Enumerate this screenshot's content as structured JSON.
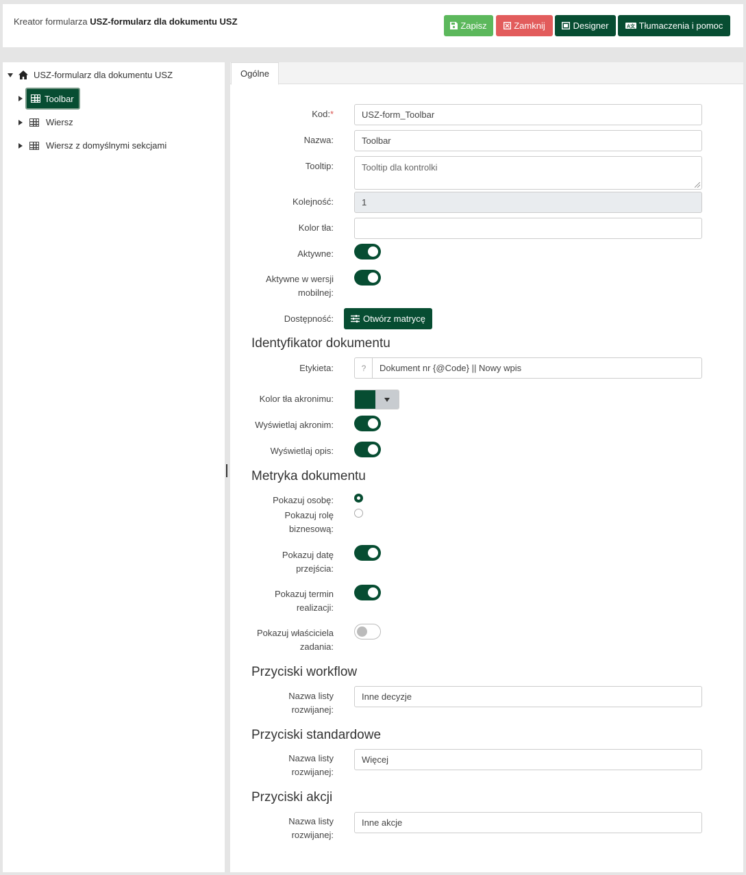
{
  "header": {
    "title_prefix": "Kreator formularza",
    "title_name": "USZ-formularz dla dokumentu USZ",
    "buttons": {
      "save": "Zapisz",
      "close": "Zamknij",
      "designer": "Designer",
      "translations": "Tłumaczenia i pomoc"
    }
  },
  "tree": {
    "root": "USZ-formularz dla dokumentu USZ",
    "items": [
      "Toolbar",
      "Wiersz",
      "Wiersz z domyślnymi sekcjami"
    ]
  },
  "tabs": [
    "Ogólne"
  ],
  "form": {
    "kod": {
      "label": "Kod:",
      "required": "*",
      "value": "USZ-form_Toolbar"
    },
    "nazwa": {
      "label": "Nazwa:",
      "value": "Toolbar"
    },
    "tooltip": {
      "label": "Tooltip:",
      "placeholder": "Tooltip dla kontrolki"
    },
    "kolejnosc": {
      "label": "Kolejność:",
      "value": "1"
    },
    "kolor_tla": {
      "label": "Kolor tła:",
      "value": ""
    },
    "aktywne": {
      "label": "Aktywne:",
      "on": true
    },
    "aktywne_mobile": {
      "label_1": "Aktywne w wersji",
      "label_2": "mobilnej:",
      "on": true
    },
    "dostepnosc": {
      "label": "Dostępność:",
      "button": "Otwórz matrycę"
    }
  },
  "identyfikator": {
    "title": "Identyfikator dokumentu",
    "etykieta": {
      "label": "Etykieta:",
      "addon": "?",
      "value": "Dokument nr {@Code} || Nowy wpis"
    },
    "kolor_akronimu": {
      "label": "Kolor tła akronimu:",
      "color": "#074d32"
    },
    "wyswietlaj_akronim": {
      "label": "Wyświetlaj akronim:",
      "on": true
    },
    "wyswietlaj_opis": {
      "label": "Wyświetlaj opis:",
      "on": true
    }
  },
  "metryka": {
    "title": "Metryka dokumentu",
    "pokazuj_osobe": {
      "label": "Pokazuj osobę:",
      "selected": true
    },
    "pokazuj_role": {
      "label_1": "Pokazuj rolę",
      "label_2": "biznesową:",
      "selected": false
    },
    "pokazuj_date": {
      "label_1": "Pokazuj datę",
      "label_2": "przejścia:",
      "on": true
    },
    "pokazuj_termin": {
      "label_1": "Pokazuj termin",
      "label_2": "realizacji:",
      "on": true
    },
    "pokazuj_wlasciciela": {
      "label_1": "Pokazuj właściciela",
      "label_2": "zadania:",
      "on": false
    }
  },
  "workflow": {
    "title": "Przyciski workflow",
    "label_1": "Nazwa listy",
    "label_2": "rozwijanej:",
    "value": "Inne decyzje"
  },
  "standardowe": {
    "title": "Przyciski standardowe",
    "label_1": "Nazwa listy",
    "label_2": "rozwijanej:",
    "value": "Więcej"
  },
  "akcji": {
    "title": "Przyciski akcji",
    "label_1": "Nazwa listy",
    "label_2": "rozwijanej:",
    "value": "Inne akcje"
  },
  "colors": {
    "primary": "#074d32",
    "success": "#5cb85c",
    "danger": "#e25c5c"
  }
}
